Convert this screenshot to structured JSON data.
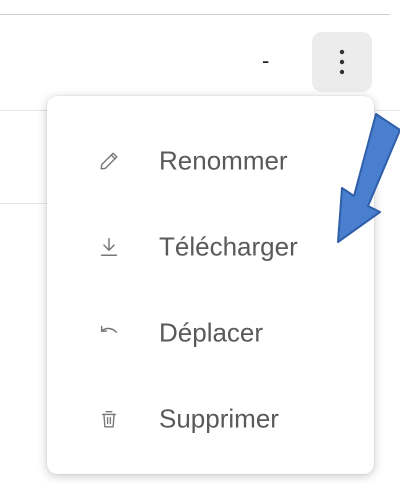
{
  "row": {
    "value": "-"
  },
  "menu": {
    "items": [
      {
        "label": "Renommer",
        "icon": "pencil-icon"
      },
      {
        "label": "Télécharger",
        "icon": "download-icon"
      },
      {
        "label": "Déplacer",
        "icon": "move-back-arrow-icon"
      },
      {
        "label": "Supprimer",
        "icon": "trash-icon"
      }
    ]
  },
  "colors": {
    "menu_text": "#5a5a5a",
    "icon": "#777777",
    "button_bg": "#ececec",
    "annotation_arrow": "#4a7fd0"
  }
}
